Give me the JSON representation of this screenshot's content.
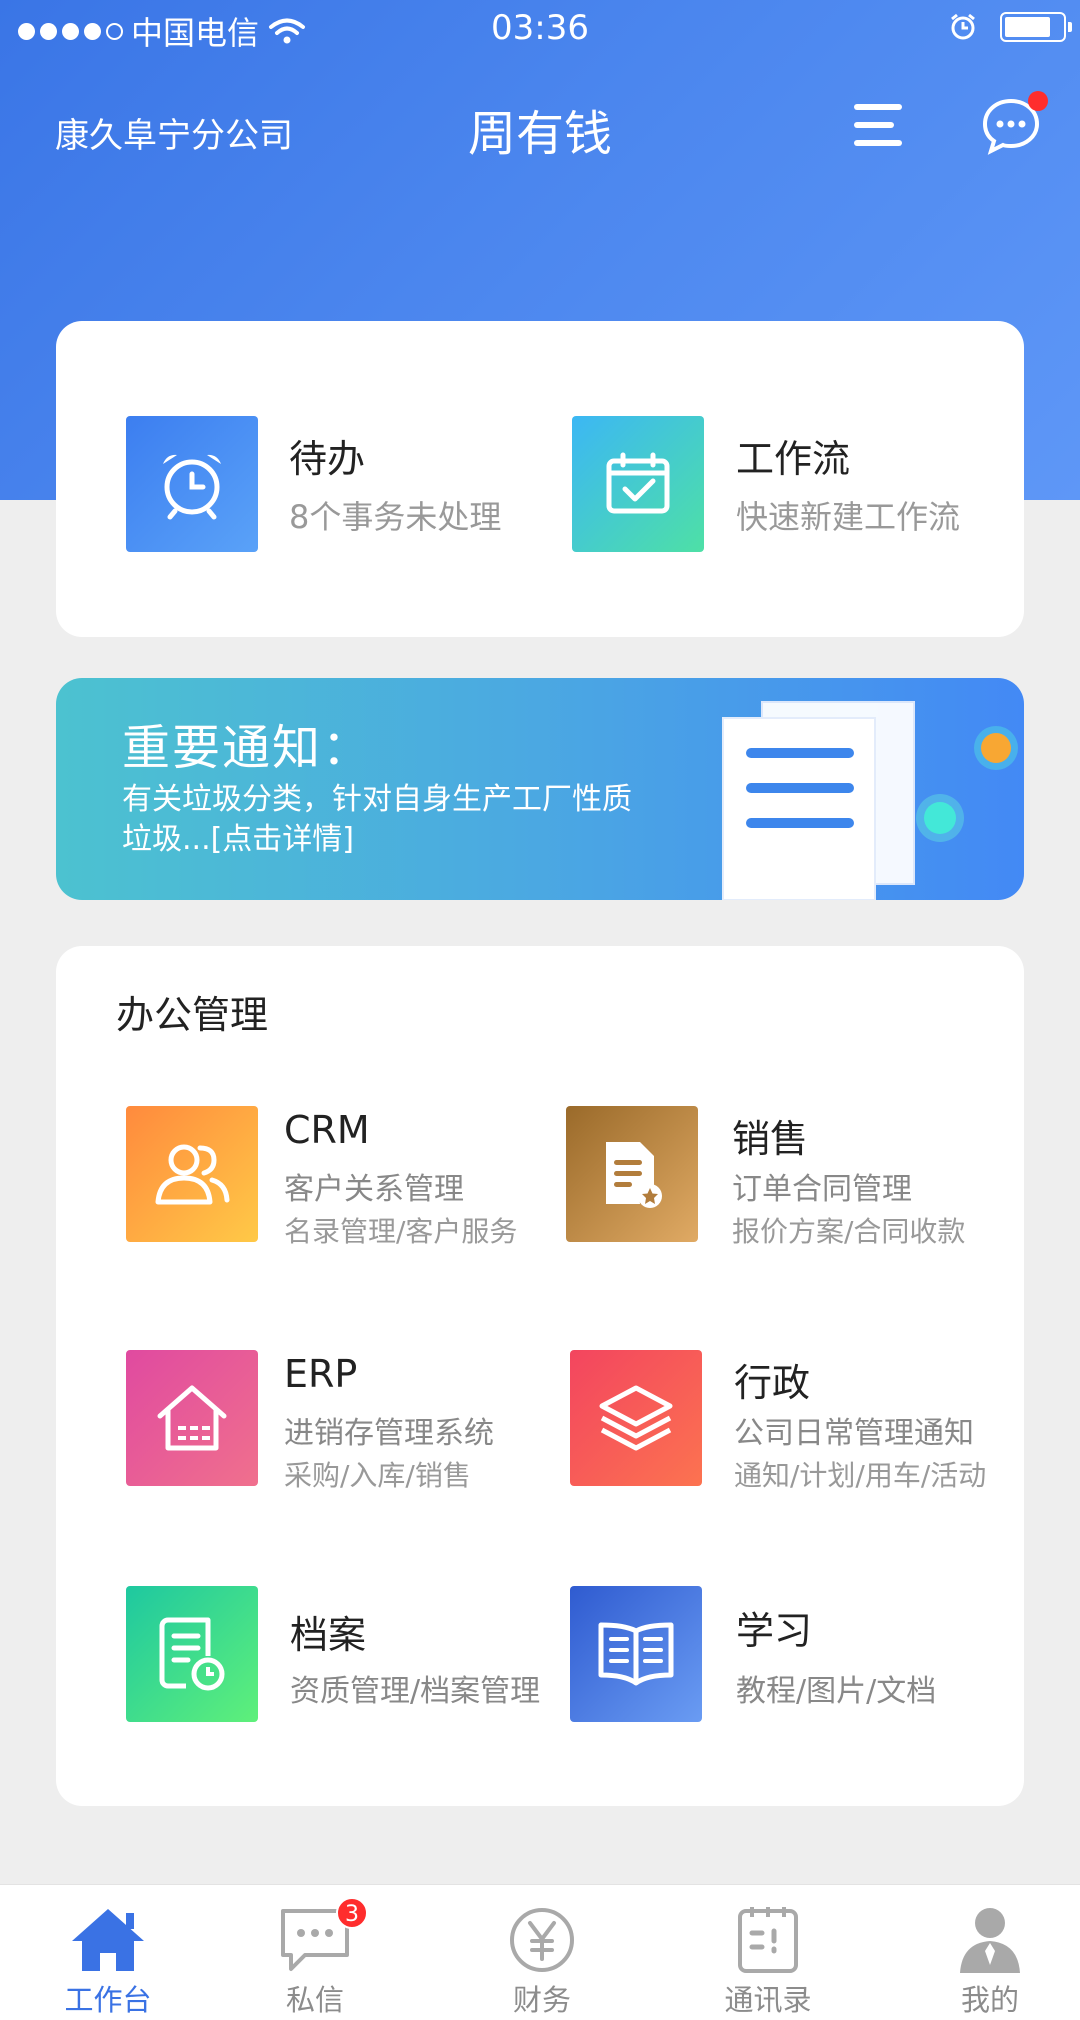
{
  "status_bar": {
    "carrier": "中国电信",
    "time": "03:36"
  },
  "header": {
    "company": "康久阜宁分公司",
    "title": "周有钱"
  },
  "quick_actions": [
    {
      "title": "待办",
      "subtitle": "8个事务未处理",
      "icon": "alarm-clock-icon"
    },
    {
      "title": "工作流",
      "subtitle": "快速新建工作流",
      "icon": "calendar-check-icon"
    }
  ],
  "notice": {
    "title": "重要通知：",
    "body": "有关垃圾分类，针对自身生产工厂性质垃圾...[点击详情]"
  },
  "office": {
    "heading": "办公管理",
    "modules": [
      {
        "title": "CRM",
        "sub1": "客户关系管理",
        "sub2": "名录管理/客户服务",
        "icon": "users-icon"
      },
      {
        "title": "销售",
        "sub1": "订单合同管理",
        "sub2": "报价方案/合同收款",
        "icon": "document-star-icon"
      },
      {
        "title": "ERP",
        "sub1": "进销存管理系统",
        "sub2": "采购/入库/销售",
        "icon": "warehouse-icon"
      },
      {
        "title": "行政",
        "sub1": "公司日常管理通知",
        "sub2": "通知/计划/用车/活动",
        "icon": "layers-icon"
      },
      {
        "title": "档案",
        "sub1": "资质管理/档案管理",
        "sub2": "",
        "icon": "archive-clock-icon"
      },
      {
        "title": "学习",
        "sub1": "教程/图片/文档",
        "sub2": "",
        "icon": "open-book-icon"
      }
    ]
  },
  "tabbar": {
    "tabs": [
      {
        "label": "工作台",
        "icon": "home-icon",
        "active": true
      },
      {
        "label": "私信",
        "icon": "chat-icon",
        "active": false
      },
      {
        "label": "财务",
        "icon": "yen-icon",
        "active": false
      },
      {
        "label": "通讯录",
        "icon": "contacts-icon",
        "active": false
      },
      {
        "label": "我的",
        "icon": "person-icon",
        "active": false
      }
    ],
    "messages_badge": "3"
  },
  "colors": {
    "brand": "#4a85ec",
    "active_tab": "#3a72e4",
    "badge": "#ff2d2d"
  }
}
